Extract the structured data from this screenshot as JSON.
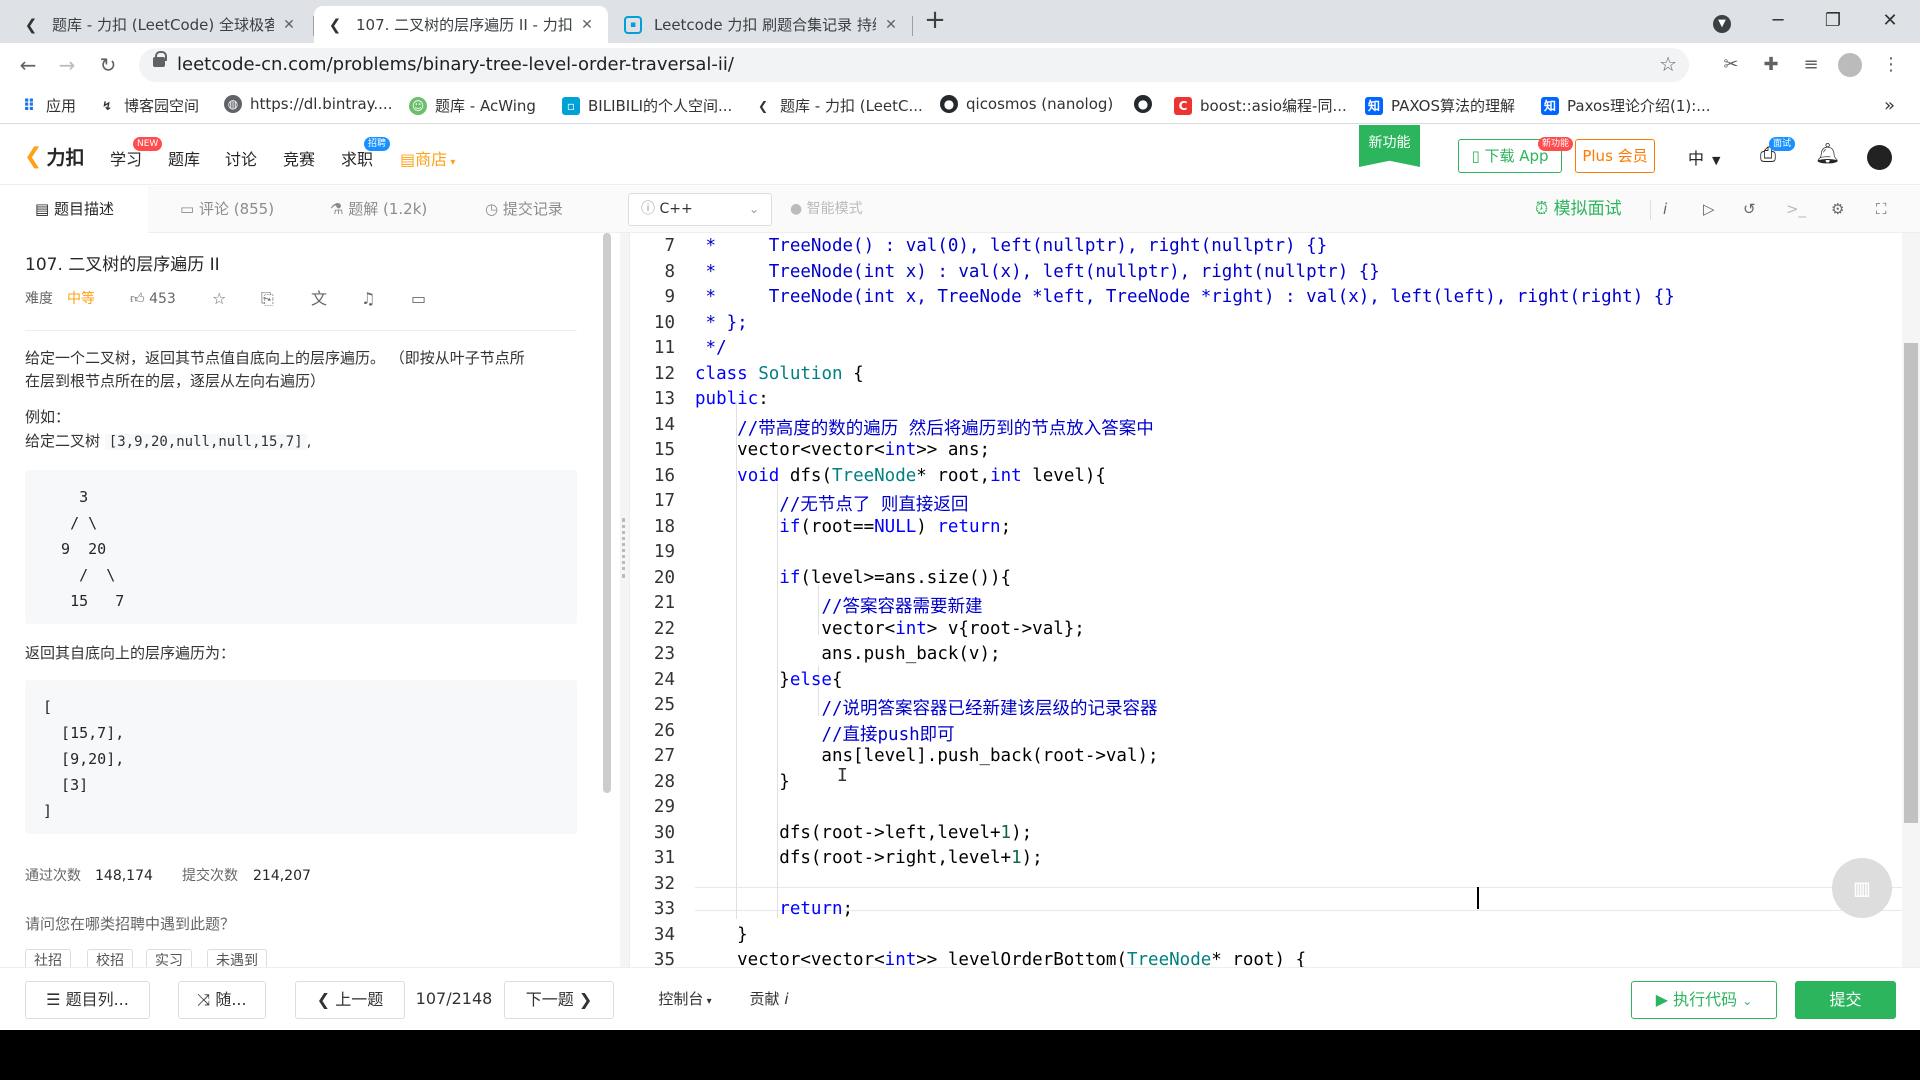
{
  "browser": {
    "tabs": [
      {
        "icon": "leetcode-icon",
        "title": "题库 - 力扣 (LeetCode) 全球极客",
        "close": "✕"
      },
      {
        "icon": "leetcode-icon",
        "title": "107. 二叉树的层序遍历 II - 力扣",
        "close": "✕"
      },
      {
        "icon": "bilibili-icon",
        "title": "Leetcode 力扣 刷题合集记录 持续",
        "close": "✕"
      }
    ],
    "new_tab": "+",
    "url": "leetcode-cn.com/problems/binary-tree-level-order-traversal-ii/",
    "bookmarks": [
      "应用",
      "博客园空间",
      "https://dl.bintray....",
      "题库 - AcWing",
      "BILIBILI的个人空间...",
      "题库 - 力扣 (LeetC...",
      "qicosmos (nanolog)",
      "",
      "boost::asio编程-同...",
      "PAXOS算法的理解",
      "Paxos理论介绍(1):..."
    ],
    "bookmarks_more": "»"
  },
  "nav": {
    "logo": "力扣",
    "items": [
      "学习",
      "题库",
      "讨论",
      "竞赛",
      "求职",
      "商店"
    ],
    "badge_new": "NEW",
    "badge_hire": "招聘",
    "new_feature": "新功能",
    "download_app": "下载 App",
    "download_badge": "新功能",
    "plus": "Plus 会员",
    "lang": "中",
    "interview_badge": "面试"
  },
  "subtabs": {
    "desc": "题目描述",
    "comments": "评论 (855)",
    "solutions": "题解 (1.2k)",
    "submissions": "提交记录",
    "language": "C++",
    "smart_mode": "智能模式",
    "mock": "模拟面试"
  },
  "problem": {
    "title": "107. 二叉树的层序遍历 II",
    "difficulty_label": "难度",
    "difficulty": "中等",
    "likes": "453",
    "desc1": "给定一个二叉树，返回其节点值自底向上的层序遍历。 （即按从叶子节点所",
    "desc2": "在层到根节点所在的层，逐层从左向右遍历）",
    "example": "例如：",
    "given": "给定二叉树",
    "given_val": "[3,9,20,null,null,15,7]",
    "given_end": ",",
    "tree": "    3\n   / \\\n  9  20\n    /  \\\n   15   7",
    "return_text": "返回其自底向上的层序遍历为：",
    "result": "[\n  [15,7],\n  [9,20],\n  [3]\n]",
    "accepted_label": "通过次数",
    "accepted": "148,174",
    "submissions_label": "提交次数",
    "submissions": "214,207",
    "question": "请问您在哪类招聘中遇到此题？",
    "tags": [
      "社招",
      "校招",
      "实习",
      "未遇到"
    ]
  },
  "code": [
    {
      "n": "7",
      "html": "<span class='cmt'> *     TreeNode() : val(0), left(nullptr), right(nullptr) {}</span>"
    },
    {
      "n": "8",
      "html": "<span class='cmt'> *     TreeNode(int x) : val(x), left(nullptr), right(nullptr) {}</span>"
    },
    {
      "n": "9",
      "html": "<span class='cmt'> *     TreeNode(int x, TreeNode *left, TreeNode *right) : val(x), left(left), right(right) {}</span>"
    },
    {
      "n": "10",
      "html": "<span class='cmt'> * };</span>"
    },
    {
      "n": "11",
      "html": "<span class='cmt'> */</span>"
    },
    {
      "n": "12",
      "html": "<span class='kw'>class</span> <span class='ty'>Solution</span> {"
    },
    {
      "n": "13",
      "html": "<span class='kw'>public</span>:"
    },
    {
      "n": "14",
      "html": "    <span class='cmt'>//带高度的数的遍历 然后将遍历到的节点放入答案中</span>"
    },
    {
      "n": "15",
      "html": "    vector&lt;vector&lt;<span class='kw'>int</span>&gt;&gt; ans;"
    },
    {
      "n": "16",
      "html": "    <span class='kw'>void</span> dfs(<span class='ty'>TreeNode</span>* root,<span class='kw'>int</span> level){"
    },
    {
      "n": "17",
      "html": "        <span class='cmt'>//无节点了 则直接返回</span>"
    },
    {
      "n": "18",
      "html": "        <span class='kw'>if</span>(root==<span class='kw'>NULL</span>) <span class='kw'>return</span>;"
    },
    {
      "n": "19",
      "html": ""
    },
    {
      "n": "20",
      "html": "        <span class='kw'>if</span>(level&gt;=ans.size()){"
    },
    {
      "n": "21",
      "html": "            <span class='cmt'>//答案容器需要新建</span>"
    },
    {
      "n": "22",
      "html": "            vector&lt;<span class='kw'>int</span>&gt; v{root-&gt;val};"
    },
    {
      "n": "23",
      "html": "            ans.push_back(v);"
    },
    {
      "n": "24",
      "html": "        }<span class='kw'>else</span>{"
    },
    {
      "n": "25",
      "html": "            <span class='cmt'>//说明答案容器已经新建该层级的记录容器</span>"
    },
    {
      "n": "26",
      "html": "            <span class='cmt'>//直接push即可</span>"
    },
    {
      "n": "27",
      "html": "            ans[level].push_back(root-&gt;val);"
    },
    {
      "n": "28",
      "html": "        }"
    },
    {
      "n": "29",
      "html": ""
    },
    {
      "n": "30",
      "html": "        dfs(root-&gt;left,level+<span class='nm'>1</span>);"
    },
    {
      "n": "31",
      "html": "        dfs(root-&gt;right,level+<span class='nm'>1</span>);"
    },
    {
      "n": "32",
      "html": ""
    },
    {
      "n": "33",
      "html": "        <span class='kw'>return</span>;"
    },
    {
      "n": "34",
      "html": "    }"
    },
    {
      "n": "35",
      "html": "    vector&lt;vector&lt;<span class='kw'>int</span>&gt;&gt; levelOrderBottom(<span class='ty'>TreeNode</span>* root) {"
    }
  ],
  "bottom": {
    "list": "题目列...",
    "random": "随...",
    "prev": "上一题",
    "page": "107/2148",
    "next": "下一题",
    "console": "控制台",
    "contribute": "贡献",
    "run": "执行代码",
    "submit": "提交"
  },
  "colors": {
    "accent": "#2db55d",
    "medium": "#ffa116",
    "plus": "#ff7a00"
  }
}
